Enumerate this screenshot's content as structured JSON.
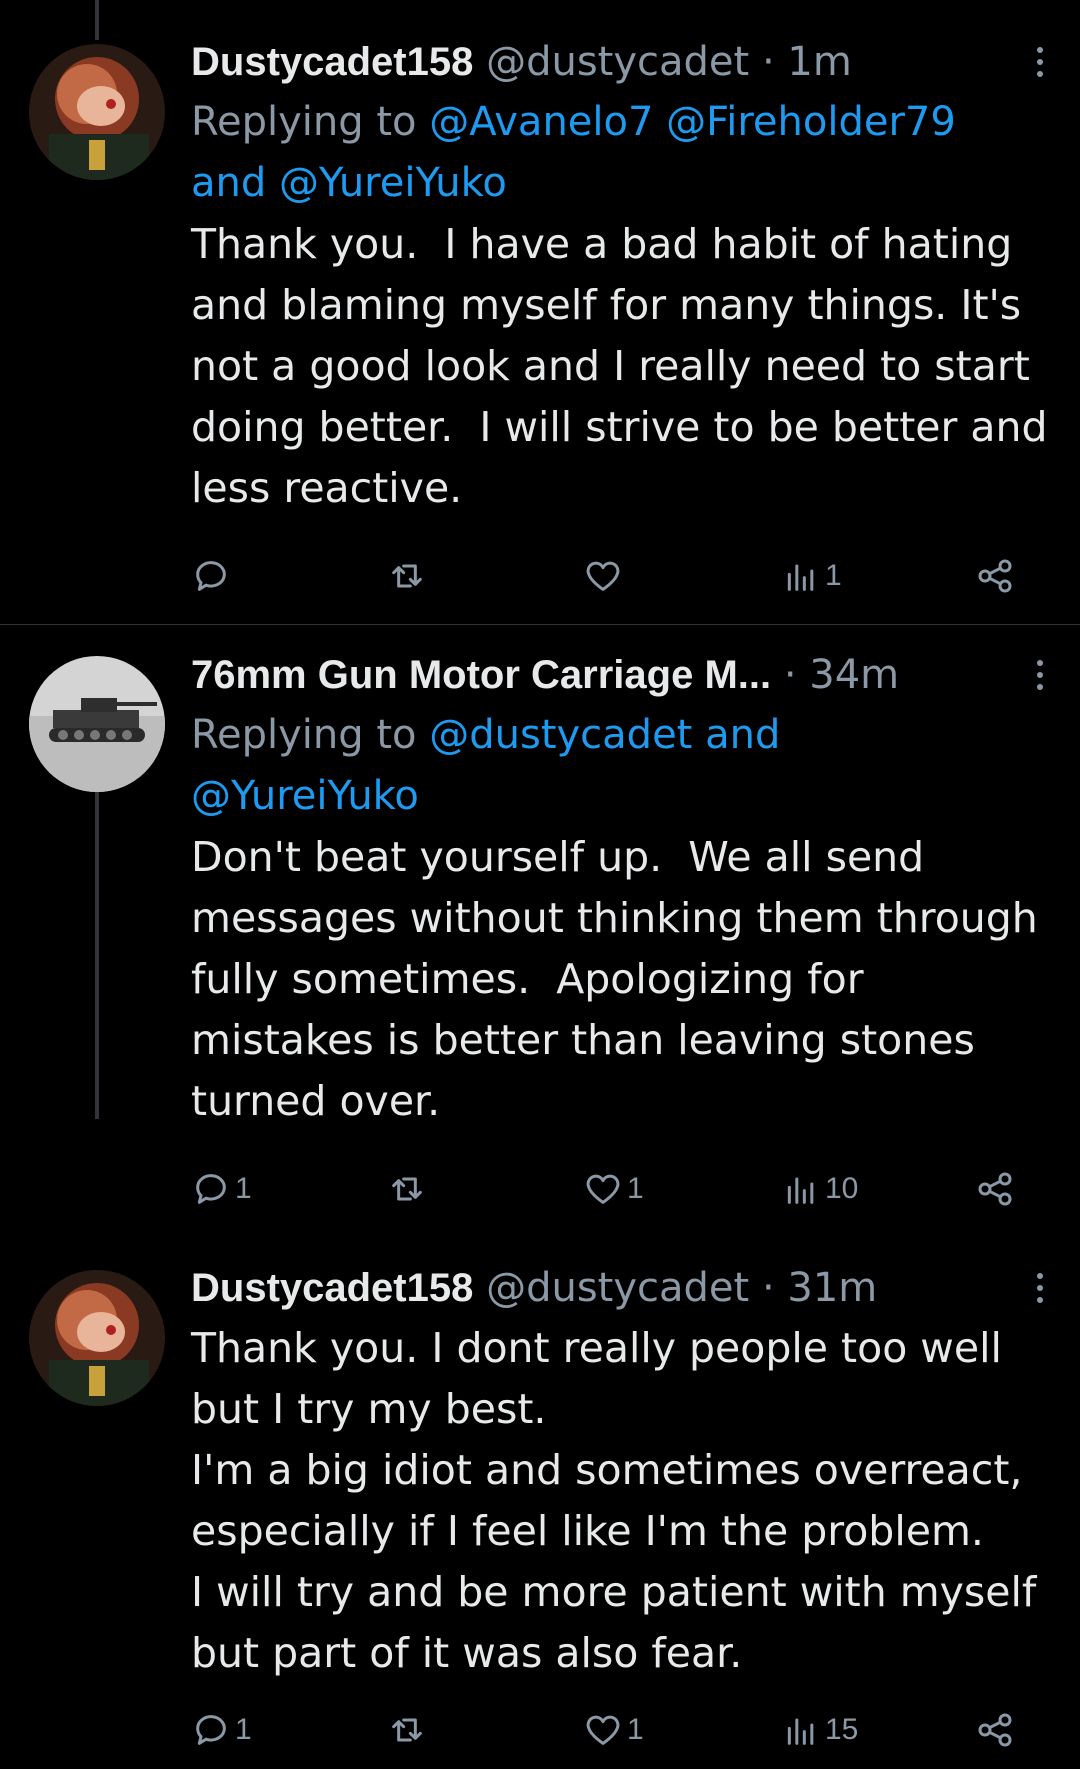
{
  "tweets": [
    {
      "name": "Dustycadet158",
      "handle": "@dustycadet",
      "time": "1m",
      "replying_prefix": "Replying to ",
      "replying_line1": "@Avanelo7 @Fireholder79",
      "replying_line2": "and @YureiYuko",
      "text": "Thank you.  I have a bad habit of hating\nand blaming myself for many things. It's\nnot a good look and I really need to start\ndoing better.  I will strive to be better and\nless reactive.",
      "replies": "",
      "retweets": "",
      "likes": "",
      "views": "1"
    },
    {
      "name": "76mm Gun Motor Carriage M...",
      "handle": "",
      "time": "34m",
      "replying_prefix": "Replying to ",
      "replying_line1": "@dustycadet and",
      "replying_line2": "@YureiYuko",
      "text": "Don't beat yourself up.  We all send\nmessages without thinking them through\nfully sometimes.  Apologizing for\nmistakes is better than leaving stones\nturned over.",
      "replies": "1",
      "retweets": "",
      "likes": "1",
      "views": "10"
    },
    {
      "name": "Dustycadet158",
      "handle": "@dustycadet",
      "time": "31m",
      "text": "Thank you. I dont really people too well\nbut I try my best.\nI'm a big idiot and sometimes overreact,\nespecially if I feel like I'm the problem.\nI will try and be more patient with myself\nbut part of it was also fear.",
      "replies": "1",
      "retweets": "",
      "likes": "1",
      "views": "15"
    }
  ],
  "colors": {
    "accent": "#1d9bf0",
    "muted": "#8b98a5",
    "text": "#e7e9ea",
    "background": "#000000"
  },
  "icons": [
    "reply-icon",
    "retweet-icon",
    "like-icon",
    "views-icon",
    "share-icon",
    "more-icon"
  ]
}
